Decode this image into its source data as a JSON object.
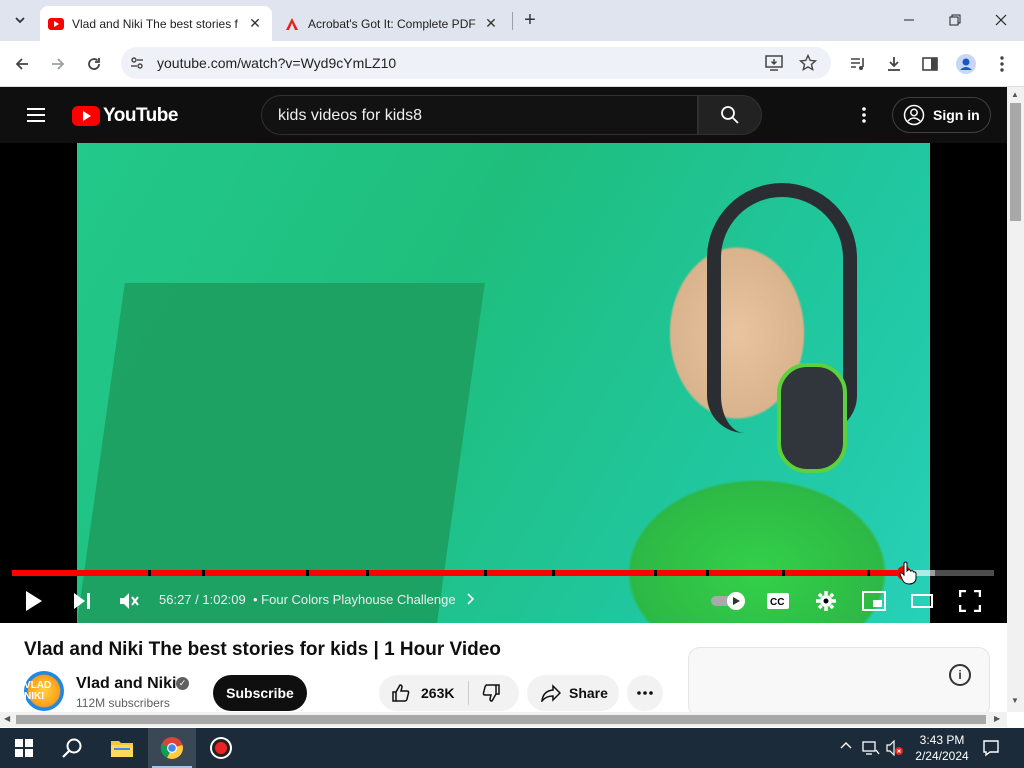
{
  "browser": {
    "tabs": [
      {
        "title": "Vlad and Niki The best stories f",
        "active": true
      },
      {
        "title": "Acrobat's Got It: Complete PDF",
        "active": false
      }
    ],
    "url": "youtube.com/watch?v=Wyd9cYmLZ10"
  },
  "youtube": {
    "logo_text": "YouTube",
    "search_query": "kids videos for kids8",
    "sign_in_label": "Sign in"
  },
  "player": {
    "time_current": "56:27",
    "time_total": "1:02:09",
    "time_display": "56:27 / 1:02:09",
    "chapter_title": "• Four Colors Playhouse Challenge",
    "progress_fraction": 0.908,
    "loaded_fraction": 1.0
  },
  "video": {
    "title": "Vlad and Niki The best stories for kids | 1 Hour Video",
    "channel_name": "Vlad and Niki",
    "channel_avatar_text": "VLAD NIKI",
    "subscribers": "112M subscribers",
    "subscribe_label": "Subscribe",
    "likes": "263K",
    "share_label": "Share"
  },
  "taskbar": {
    "time": "3:43 PM",
    "date": "2/24/2024"
  },
  "colors": {
    "yt_red": "#ff0000",
    "yt_dark": "#0f0f0f",
    "taskbar": "#1c2b3a"
  }
}
